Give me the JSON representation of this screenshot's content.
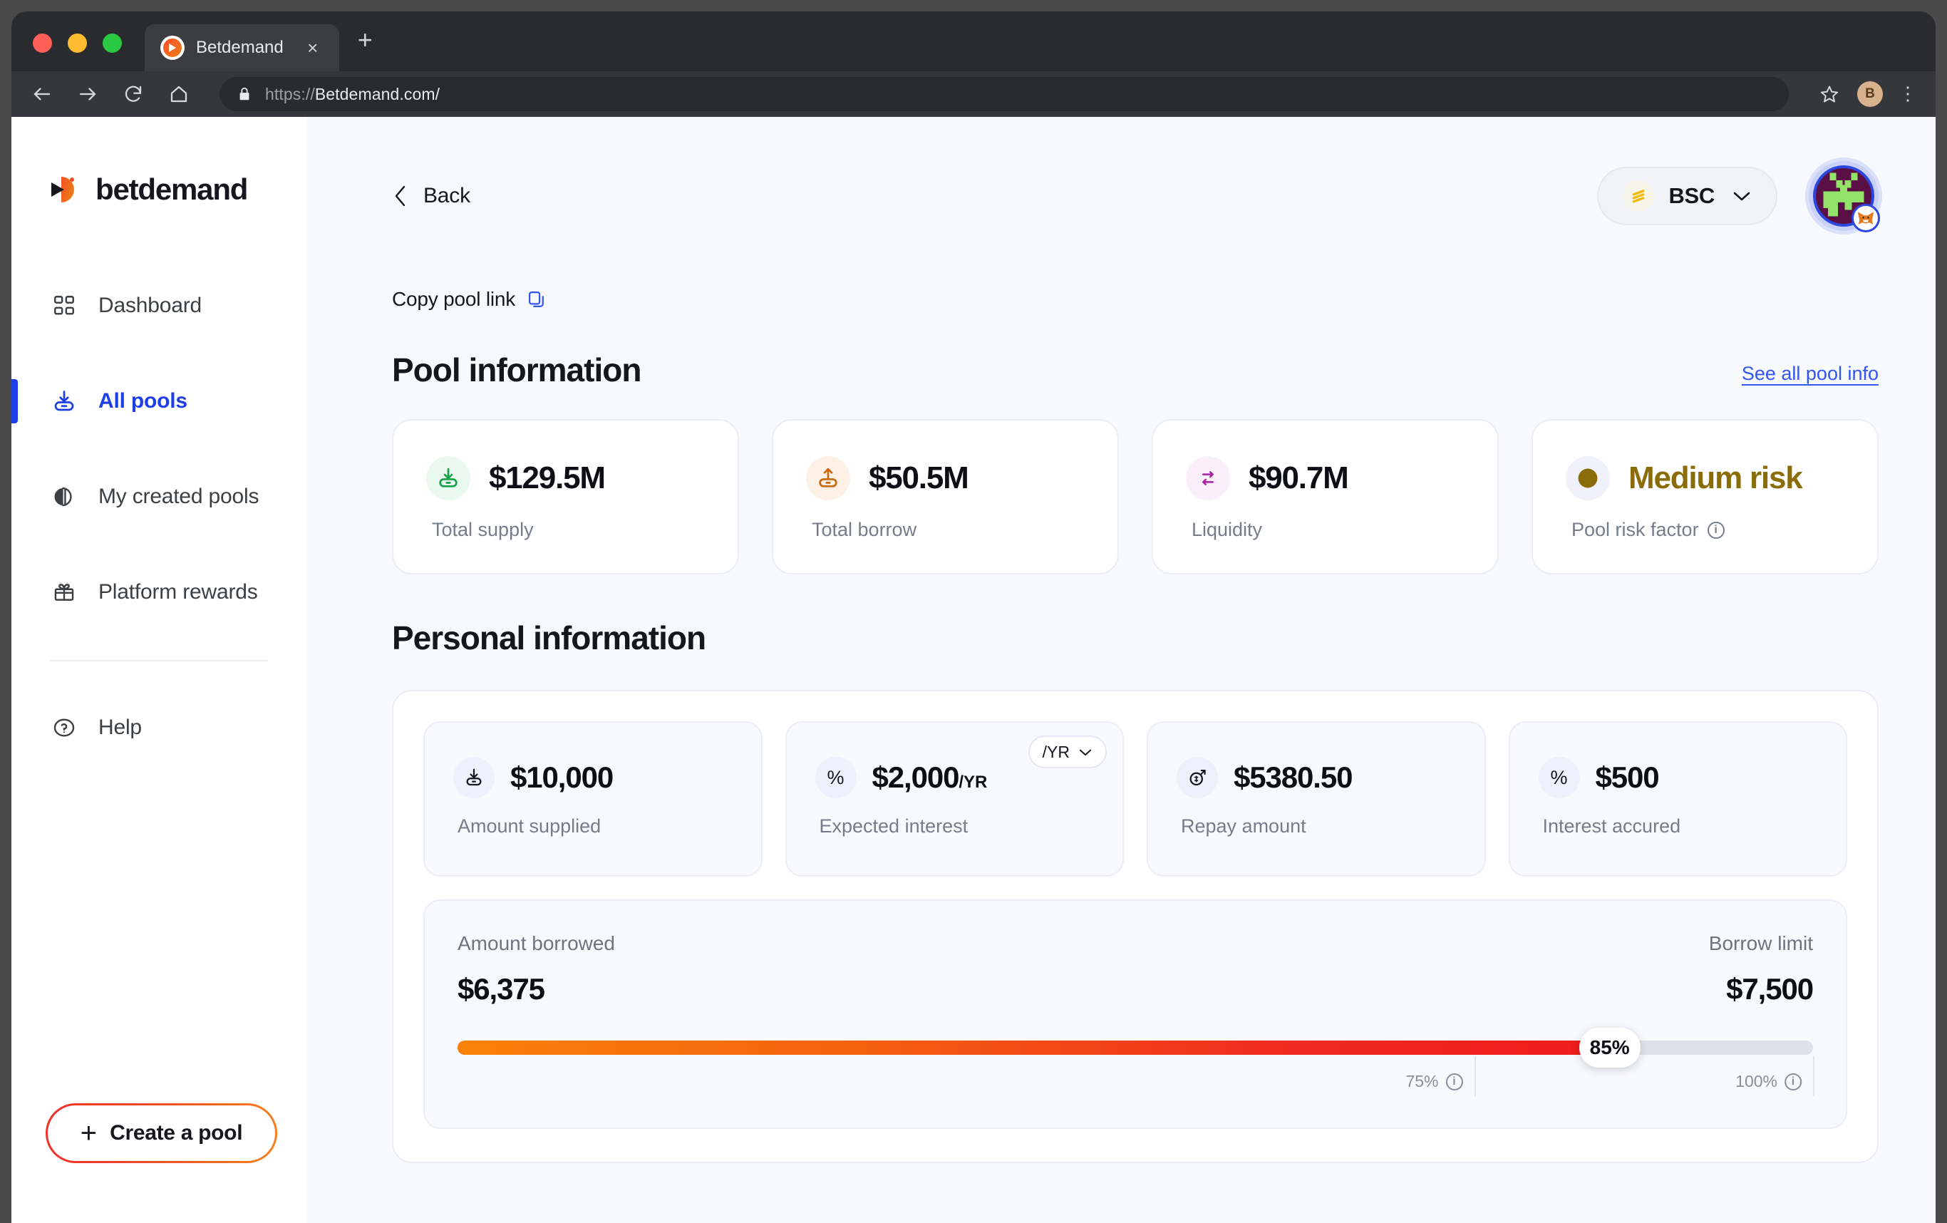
{
  "browser": {
    "tab_title": "Betdemand",
    "tab_close": "×",
    "new_tab": "+",
    "url_scheme": "https://",
    "url_host": "Betdemand.com/",
    "profile_initial": "B",
    "menu_glyph": "⋮"
  },
  "sidebar": {
    "brand": "betdemand",
    "items": [
      {
        "label": "Dashboard",
        "icon": "grid-icon",
        "active": false
      },
      {
        "label": "All pools",
        "icon": "supply-icon",
        "active": true
      },
      {
        "label": "My created pools",
        "icon": "pools-icon",
        "active": false
      },
      {
        "label": "Platform rewards",
        "icon": "gift-icon",
        "active": false
      }
    ],
    "help": {
      "label": "Help",
      "icon": "question-circle-icon"
    },
    "create_pool": {
      "label": "Create a pool",
      "plus": "+"
    }
  },
  "topbar": {
    "back_label": "Back",
    "chain": {
      "label": "BSC",
      "icon": "bnb-icon"
    },
    "wallet": {
      "badge": "metamask-icon"
    }
  },
  "copy_link": {
    "label": "Copy pool link",
    "icon": "copy-icon"
  },
  "pool_information": {
    "title": "Pool information",
    "see_all_link": "See all pool info",
    "cards": [
      {
        "value": "$129.5M",
        "label": "Total supply",
        "icon": "supply-icon",
        "bubble_bg": "#e9f9ef",
        "icon_color": "#16a24a",
        "has_info": false
      },
      {
        "value": "$50.5M",
        "label": "Total borrow",
        "icon": "borrow-icon",
        "bubble_bg": "#fdf0e4",
        "icon_color": "#c96a10",
        "has_info": false
      },
      {
        "value": "$90.7M",
        "label": "Liquidity",
        "icon": "swap-icon",
        "bubble_bg": "#fbeefb",
        "icon_color": "#a81fa8",
        "has_info": false
      },
      {
        "value": "Medium risk",
        "label": "Pool risk factor",
        "icon": "risk-dot-icon",
        "bubble_bg": "#f0f1fb",
        "icon_color": "#8a6d08",
        "value_color": "#8a6d08",
        "has_info": true
      }
    ]
  },
  "personal_information": {
    "title": "Personal information",
    "cards": [
      {
        "value": "$10,000",
        "suffix": "",
        "label": "Amount supplied",
        "icon": "supply-icon"
      },
      {
        "value": "$2,000",
        "suffix": "/YR",
        "label": "Expected interest",
        "icon": "percent-icon",
        "chip": {
          "label": "/YR",
          "caret": "chevron-down-icon"
        }
      },
      {
        "value": "$5380.50",
        "suffix": "",
        "label": "Repay amount",
        "icon": "repay-icon"
      },
      {
        "value": "$500",
        "suffix": "",
        "label": "Interest accured",
        "icon": "percent-icon"
      }
    ],
    "borrow": {
      "left_caption": "Amount borrowed",
      "right_caption": "Borrow limit",
      "left_amount": "$6,375",
      "right_amount": "$7,500",
      "progress_label": "85%",
      "progress_percent": 85,
      "ticks": [
        {
          "label": "75%",
          "percent": 75
        },
        {
          "label": "100%",
          "percent": 100
        }
      ]
    }
  },
  "colors": {
    "accent_blue": "#1d3fe8",
    "link_blue": "#3355f0",
    "orange": "#f58220",
    "red": "#f0302b",
    "risk_gold": "#8a6d08",
    "page_bg": "#f8f9fc"
  }
}
